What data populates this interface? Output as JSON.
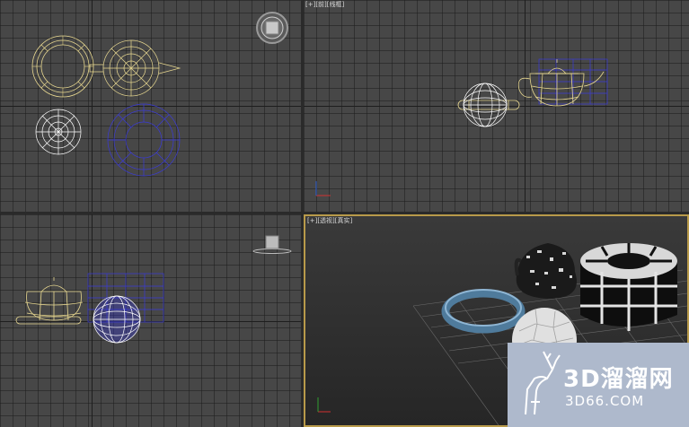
{
  "viewports": {
    "top_left": {
      "label": ""
    },
    "top_right": {
      "label_parts": [
        "[+]",
        "[前]",
        "[线框]"
      ]
    },
    "bottom_left": {
      "label": ""
    },
    "bottom_right": {
      "label_parts": [
        "[+]",
        "[透视]",
        "[真实]"
      ]
    }
  },
  "watermark": {
    "brand_cn": "3D溜溜网",
    "brand_en": "3D66.COM"
  },
  "colors": {
    "grid_bg": "#474747",
    "selected_wire": "#e8d890",
    "unselected_wire": "#3a3ad8",
    "white_wire": "#ffffff",
    "active_border": "#b89a4a"
  }
}
